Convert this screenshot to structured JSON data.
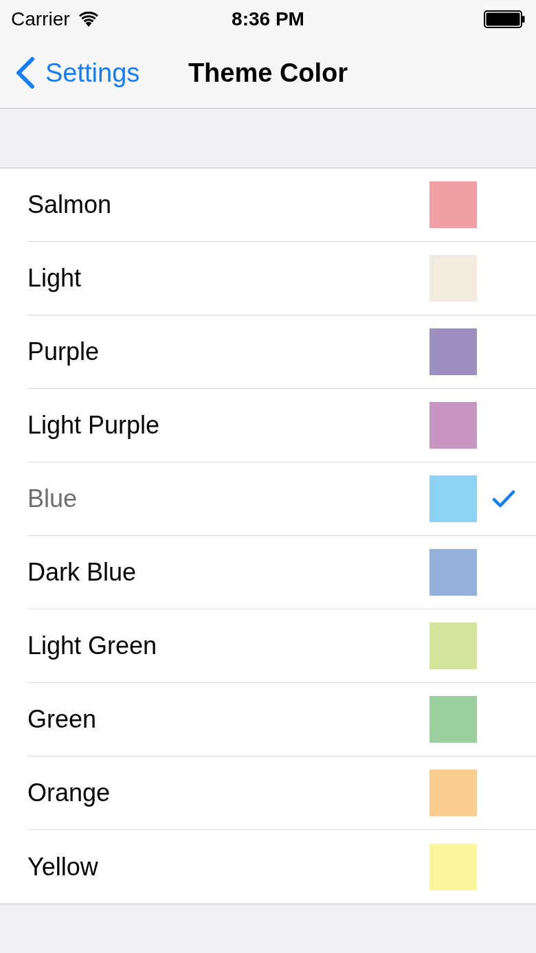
{
  "status_bar": {
    "carrier": "Carrier",
    "time": "8:36 PM"
  },
  "nav_bar": {
    "back": "Settings",
    "title": "Theme Color"
  },
  "items": [
    {
      "name": "Salmon",
      "color": "#f0a0a4",
      "selected": false
    },
    {
      "name": "Light",
      "color": "#f2ece0",
      "selected": false
    },
    {
      "name": "Purple",
      "color": "#9c8ebf",
      "selected": false
    },
    {
      "name": "Light Purple",
      "color": "#c897c1",
      "selected": false
    },
    {
      "name": "Blue",
      "color": "#8dd1f3",
      "selected": true
    },
    {
      "name": "Dark Blue",
      "color": "#93b1da",
      "selected": false
    },
    {
      "name": "Light Green",
      "color": "#d6e59c",
      "selected": false
    },
    {
      "name": "Green",
      "color": "#9bcf9f",
      "selected": false
    },
    {
      "name": "Orange",
      "color": "#f8cd8f",
      "selected": false
    },
    {
      "name": "Yellow",
      "color": "#fbf59e",
      "selected": false
    }
  ]
}
